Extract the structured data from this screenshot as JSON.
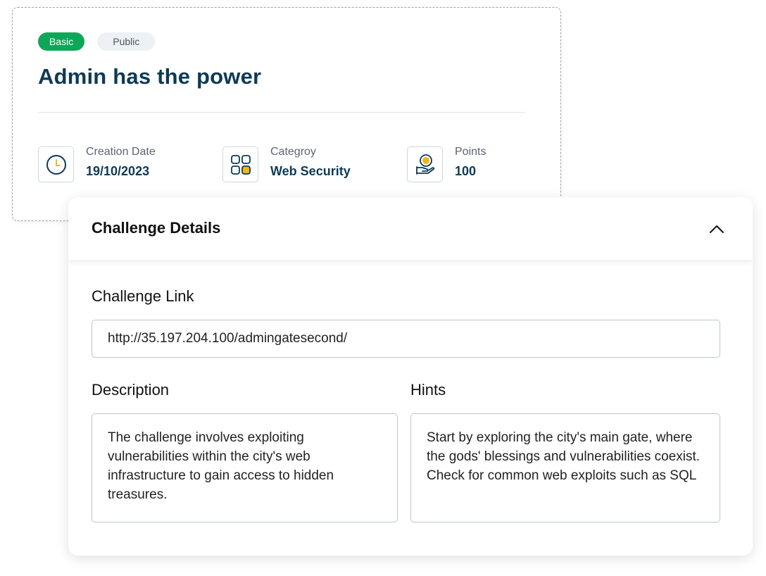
{
  "challenge": {
    "badges": {
      "level": "Basic",
      "visibility": "Public"
    },
    "title": "Admin has the power",
    "meta": {
      "creation_date": {
        "label": "Creation Date",
        "value": "19/10/2023",
        "icon": "clock-icon"
      },
      "category": {
        "label": "Categroy",
        "value": "Web Security",
        "icon": "category-grid-icon"
      },
      "points": {
        "label": "Points",
        "value": "100",
        "icon": "coin-hand-icon"
      }
    }
  },
  "details": {
    "title": "Challenge Details",
    "collapse_icon": "chevron-up-icon",
    "link_label": "Challenge Link",
    "link_value": "http://35.197.204.100/admingatesecond/",
    "description_label": "Description",
    "description_text": "The challenge involves exploiting vulnerabilities within the city's web infrastructure to gain access to hidden treasures.",
    "hints_label": "Hints",
    "hints_text": "Start by exploring the city's main gate, where the gods' blessings and vulnerabilities coexist. Check for common web exploits such as SQL"
  },
  "colors": {
    "primary_navy": "#0d3a56",
    "badge_green": "#0ea75a",
    "accent_yellow": "#f2b619"
  }
}
